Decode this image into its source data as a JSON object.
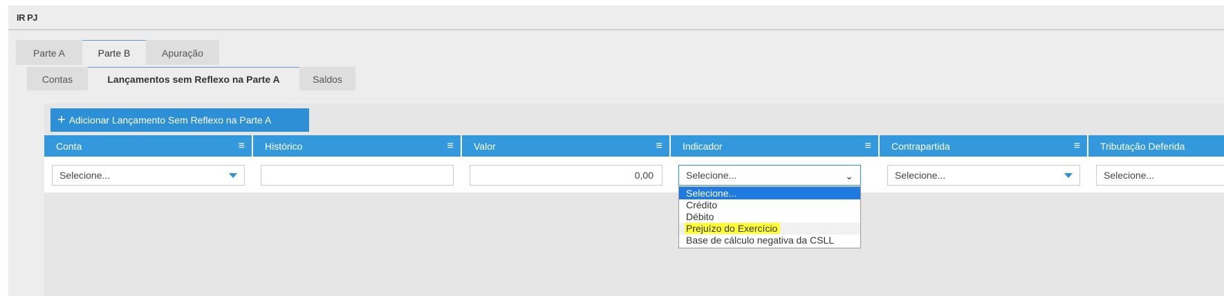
{
  "header": {
    "title": "IR PJ"
  },
  "tabs": [
    {
      "label": "Parte A",
      "active": false
    },
    {
      "label": "Parte B",
      "active": true
    },
    {
      "label": "Apuração",
      "active": false
    }
  ],
  "subtabs": [
    {
      "label": "Contas",
      "active": false
    },
    {
      "label": "Lançamentos sem Reflexo na Parte A",
      "active": true
    },
    {
      "label": "Saldos",
      "active": false
    }
  ],
  "toolbar": {
    "add_label": "Adicionar Lançamento Sem Reflexo na Parte A"
  },
  "grid": {
    "columns": [
      {
        "label": "Conta"
      },
      {
        "label": "Histórico"
      },
      {
        "label": "Valor"
      },
      {
        "label": "Indicador"
      },
      {
        "label": "Contrapartida"
      },
      {
        "label": "Tributação Deferida"
      }
    ],
    "row": {
      "conta": "Selecione...",
      "historico": "",
      "valor": "0,00",
      "indicador": "Selecione...",
      "contrapartida": "Selecione...",
      "tributacao": "Selecione..."
    }
  },
  "indicador_options": [
    "Selecione...",
    "Crédito",
    "Débito",
    "Prejuízo do Exercício",
    "Base de cálculo negativa da CSLL"
  ],
  "colors": {
    "accent": "#3499dc",
    "button": "#2d8fd6",
    "highlight": "#ffff33",
    "selected_option": "#1e7ae0"
  }
}
